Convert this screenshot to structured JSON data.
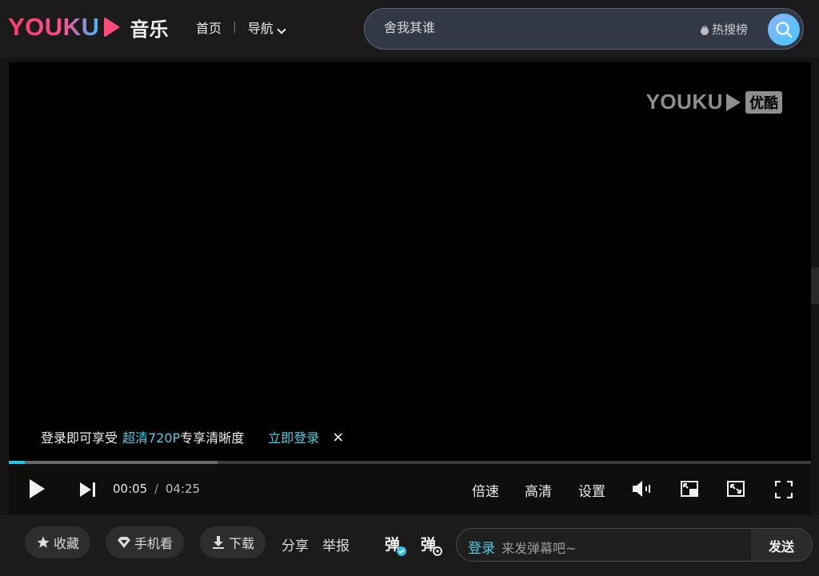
{
  "header": {
    "logo_text": "YOUKU",
    "logo_sub": "音乐",
    "nav": {
      "home": "首页",
      "separator": "|",
      "guide": "导航"
    },
    "search": {
      "placeholder": "舍我其谁",
      "hot_label": "热搜榜"
    }
  },
  "player": {
    "watermark": {
      "brand": "YOUKU",
      "cn": "优酷"
    },
    "login_tip": {
      "prefix": "登录即可享受",
      "highlight": "超清720P",
      "suffix": "专享清晰度",
      "action": "立即登录",
      "close": "×"
    },
    "progress": {
      "played_fraction": 0.02,
      "buffered_fraction": 0.26
    },
    "time": {
      "current": "00:05",
      "separator": "/",
      "total": "04:25"
    },
    "controls": {
      "speed": "倍速",
      "quality": "高清",
      "settings": "设置"
    }
  },
  "bottom": {
    "favorite": "收藏",
    "mobile": "手机看",
    "download": "下载",
    "share": "分享",
    "report": "举报",
    "danmu_on": "弹",
    "danmu_settings": "弹",
    "danmu_input": {
      "login": "登录",
      "placeholder": "来发弹幕吧~",
      "send": "发送"
    }
  },
  "colors": {
    "accent": "#2ec3e6",
    "brand_pink": "#ff4d7a",
    "background": "#141414"
  }
}
